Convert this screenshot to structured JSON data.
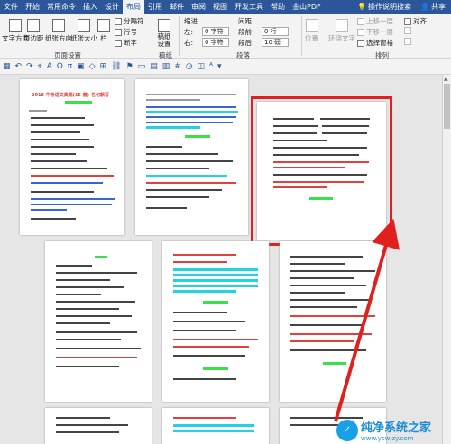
{
  "tabs": [
    "文件",
    "开始",
    "常用命令",
    "插入",
    "设计",
    "布局",
    "引用",
    "邮件",
    "审阅",
    "视图",
    "开发工具",
    "帮助",
    "金山PDF"
  ],
  "active_tab_index": 5,
  "help_search": "操作说明搜索",
  "share": "共享",
  "ribbon": {
    "text_direction": "文字方向",
    "margins": "页边距",
    "orientation": "纸张方向",
    "size": "纸张大小",
    "columns": "栏",
    "breaks": "分隔符",
    "line_numbers": "行号",
    "hyphenation": "断字",
    "page_setup_label": "页面设置",
    "draft_paper": "稿纸设置",
    "draft_label": "稿纸",
    "indent_header": "缩进",
    "spacing_header": "间距",
    "indent_left_label": "左:",
    "indent_left_value": "0 字符",
    "indent_right_label": "右:",
    "indent_right_value": "0 字符",
    "spacing_before_label": "段前:",
    "spacing_before_value": "0 行",
    "spacing_after_label": "段后:",
    "spacing_after_value": "10 磅",
    "paragraph_label": "段落",
    "position": "位置",
    "wrap_text": "环绕文字",
    "bring_forward": "上移一层",
    "send_backward": "下移一层",
    "selection_pane": "选择窗格",
    "align": "对齐",
    "arrange_label": "排列"
  },
  "page1_title": "2018 中考语文真题(15 套)-名句默写",
  "watermark": {
    "main": "纯净系统之家",
    "sub": "www.ycwjzy.com"
  },
  "colors": {
    "ribbon_blue": "#2b579a",
    "highlight_red": "#e01f1f",
    "text_red": "#e0413a",
    "text_blue": "#3a63d6",
    "highlight_cyan": "#22d3e6",
    "highlight_green": "#3ae04a"
  }
}
